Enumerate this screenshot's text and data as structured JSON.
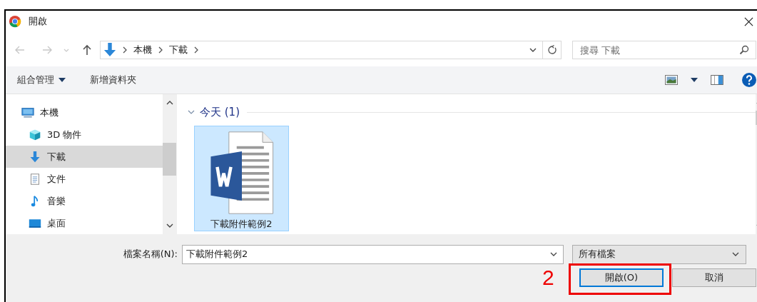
{
  "window": {
    "title": "開啟"
  },
  "address": {
    "path": [
      "本機",
      "下載"
    ],
    "search_placeholder": "搜尋 下載"
  },
  "toolbar": {
    "organize": "組合管理",
    "new_folder": "新增資料夾"
  },
  "sidebar": {
    "items": [
      {
        "label": "本機",
        "selected": false,
        "children": [
          {
            "label": "3D 物件",
            "selected": false
          },
          {
            "label": "下載",
            "selected": true
          },
          {
            "label": "文件",
            "selected": false
          },
          {
            "label": "音樂",
            "selected": false
          },
          {
            "label": "桌面",
            "selected": false
          }
        ]
      }
    ]
  },
  "content": {
    "groups": [
      {
        "label": "今天 (1)",
        "expanded": true,
        "files": [
          {
            "name": "下載附件範例2",
            "selected": true
          }
        ]
      }
    ]
  },
  "footer": {
    "filename_label": "檔案名稱(N):",
    "filename": "下載附件範例2",
    "filter": "所有檔案",
    "buttons": [
      {
        "label": "開啟(O)",
        "default": true
      },
      {
        "label": "取消",
        "default": false
      }
    ]
  },
  "annotation": {
    "label": "2"
  }
}
